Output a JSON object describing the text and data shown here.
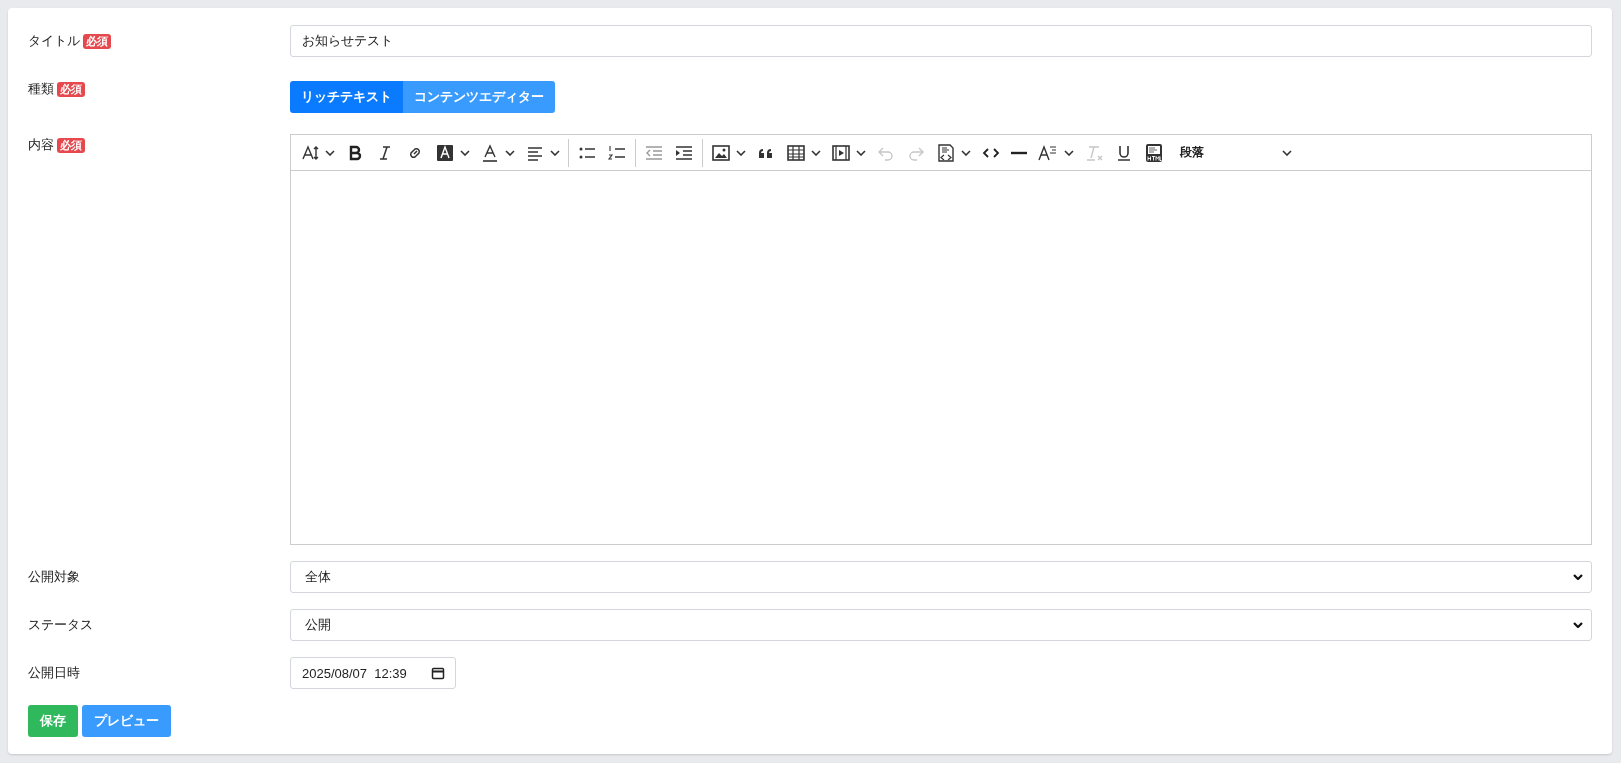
{
  "fields": [
    {
      "kind": "text",
      "label": "タイトル",
      "badge": "必須",
      "value": "お知らせテスト"
    },
    {
      "kind": "toggle",
      "label": "種類",
      "badge": "必須",
      "options": [
        {
          "label": "リッチテキスト",
          "selected": true
        },
        {
          "label": "コンテンツエディター",
          "selected": false
        }
      ]
    },
    {
      "kind": "editor",
      "label": "内容",
      "badge": "必須",
      "toolbar": {
        "undo": {
          "disabled": true
        },
        "redo": {
          "disabled": true
        },
        "clear_format": {
          "disabled": true
        },
        "block_format": "段落"
      }
    },
    {
      "kind": "select",
      "label": "公開対象",
      "value": "全体"
    },
    {
      "kind": "select",
      "label": "ステータス",
      "value": "公開"
    },
    {
      "kind": "datetime",
      "label": "公開日時",
      "value": "2025/08/07  12:39"
    }
  ],
  "buttons": [
    {
      "label": "保存",
      "kind": "success"
    },
    {
      "label": "プレビュー",
      "kind": "info"
    }
  ]
}
